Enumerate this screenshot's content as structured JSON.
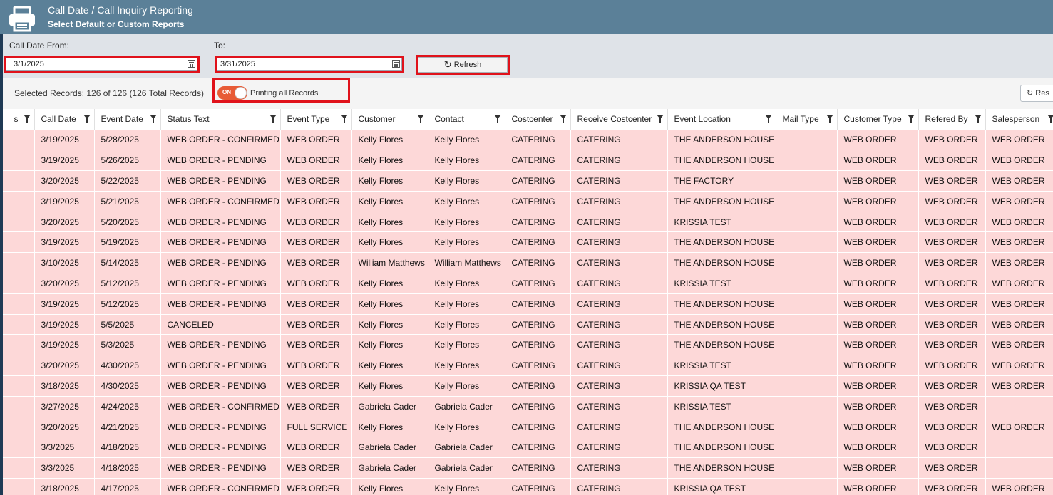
{
  "header": {
    "title": "Call Date / Call Inquiry Reporting",
    "subtitle": "Select Default or Custom Reports",
    "icon": "printer-icon"
  },
  "filters": {
    "from_label": "Call Date From:",
    "from_value": "3/1/2025",
    "to_label": "To:",
    "to_value": "3/31/2025",
    "refresh_label": "Refresh"
  },
  "records": {
    "summary": "Selected Records: 126 of 126 (126 Total Records)",
    "toggle_state": "ON",
    "toggle_label": "Printing all Records",
    "reset_label": "Res"
  },
  "table": {
    "columns": [
      "s",
      "Call Date",
      "Event Date",
      "Status Text",
      "Event Type",
      "Customer",
      "Contact",
      "Costcenter",
      "Receive Costcenter",
      "Event Location",
      "Mail Type",
      "Customer Type",
      "Refered By",
      "Salesperson"
    ],
    "rows": [
      [
        "",
        "3/19/2025",
        "5/28/2025",
        "WEB ORDER - CONFIRMED",
        "WEB ORDER",
        "Kelly Flores",
        "Kelly Flores",
        "CATERING",
        "CATERING",
        "THE ANDERSON HOUSE",
        "",
        "WEB ORDER",
        "WEB ORDER",
        "WEB ORDER"
      ],
      [
        "",
        "3/19/2025",
        "5/26/2025",
        "WEB ORDER - PENDING",
        "WEB ORDER",
        "Kelly Flores",
        "Kelly Flores",
        "CATERING",
        "CATERING",
        "THE ANDERSON HOUSE",
        "",
        "WEB ORDER",
        "WEB ORDER",
        "WEB ORDER"
      ],
      [
        "",
        "3/20/2025",
        "5/22/2025",
        "WEB ORDER - PENDING",
        "WEB ORDER",
        "Kelly Flores",
        "Kelly Flores",
        "CATERING",
        "CATERING",
        "THE FACTORY",
        "",
        "WEB ORDER",
        "WEB ORDER",
        "WEB ORDER"
      ],
      [
        "",
        "3/19/2025",
        "5/21/2025",
        "WEB ORDER - CONFIRMED",
        "WEB ORDER",
        "Kelly Flores",
        "Kelly Flores",
        "CATERING",
        "CATERING",
        "THE ANDERSON HOUSE",
        "",
        "WEB ORDER",
        "WEB ORDER",
        "WEB ORDER"
      ],
      [
        "",
        "3/20/2025",
        "5/20/2025",
        "WEB ORDER - PENDING",
        "WEB ORDER",
        "Kelly Flores",
        "Kelly Flores",
        "CATERING",
        "CATERING",
        "KRISSIA TEST",
        "",
        "WEB ORDER",
        "WEB ORDER",
        "WEB ORDER"
      ],
      [
        "",
        "3/19/2025",
        "5/19/2025",
        "WEB ORDER - PENDING",
        "WEB ORDER",
        "Kelly Flores",
        "Kelly Flores",
        "CATERING",
        "CATERING",
        "THE ANDERSON HOUSE",
        "",
        "WEB ORDER",
        "WEB ORDER",
        "WEB ORDER"
      ],
      [
        "",
        "3/10/2025",
        "5/14/2025",
        "WEB ORDER - PENDING",
        "WEB ORDER",
        "William Matthews",
        "William Matthews",
        "CATERING",
        "CATERING",
        "THE ANDERSON HOUSE",
        "",
        "WEB ORDER",
        "WEB ORDER",
        "WEB ORDER"
      ],
      [
        "",
        "3/20/2025",
        "5/12/2025",
        "WEB ORDER - PENDING",
        "WEB ORDER",
        "Kelly Flores",
        "Kelly Flores",
        "CATERING",
        "CATERING",
        "KRISSIA TEST",
        "",
        "WEB ORDER",
        "WEB ORDER",
        "WEB ORDER"
      ],
      [
        "",
        "3/19/2025",
        "5/12/2025",
        "WEB ORDER - PENDING",
        "WEB ORDER",
        "Kelly Flores",
        "Kelly Flores",
        "CATERING",
        "CATERING",
        "THE ANDERSON HOUSE",
        "",
        "WEB ORDER",
        "WEB ORDER",
        "WEB ORDER"
      ],
      [
        "",
        "3/19/2025",
        "5/5/2025",
        "CANCELED",
        "WEB ORDER",
        "Kelly Flores",
        "Kelly Flores",
        "CATERING",
        "CATERING",
        "THE ANDERSON HOUSE",
        "",
        "WEB ORDER",
        "WEB ORDER",
        "WEB ORDER"
      ],
      [
        "",
        "3/19/2025",
        "5/3/2025",
        "WEB ORDER - PENDING",
        "WEB ORDER",
        "Kelly Flores",
        "Kelly Flores",
        "CATERING",
        "CATERING",
        "THE ANDERSON HOUSE",
        "",
        "WEB ORDER",
        "WEB ORDER",
        "WEB ORDER"
      ],
      [
        "",
        "3/20/2025",
        "4/30/2025",
        "WEB ORDER - PENDING",
        "WEB ORDER",
        "Kelly Flores",
        "Kelly Flores",
        "CATERING",
        "CATERING",
        "KRISSIA TEST",
        "",
        "WEB ORDER",
        "WEB ORDER",
        "WEB ORDER"
      ],
      [
        "",
        "3/18/2025",
        "4/30/2025",
        "WEB ORDER - PENDING",
        "WEB ORDER",
        "Kelly Flores",
        "Kelly Flores",
        "CATERING",
        "CATERING",
        "KRISSIA QA TEST",
        "",
        "WEB ORDER",
        "WEB ORDER",
        "WEB ORDER"
      ],
      [
        "",
        "3/27/2025",
        "4/24/2025",
        "WEB ORDER - CONFIRMED",
        "WEB ORDER",
        "Gabriela Cader",
        "Gabriela Cader",
        "CATERING",
        "CATERING",
        "KRISSIA TEST",
        "",
        "WEB ORDER",
        "WEB ORDER",
        ""
      ],
      [
        "",
        "3/20/2025",
        "4/21/2025",
        "WEB ORDER - PENDING",
        "FULL SERVICE",
        "Kelly Flores",
        "Kelly Flores",
        "CATERING",
        "CATERING",
        "THE ANDERSON HOUSE",
        "",
        "WEB ORDER",
        "WEB ORDER",
        "WEB ORDER"
      ],
      [
        "",
        "3/3/2025",
        "4/18/2025",
        "WEB ORDER - PENDING",
        "WEB ORDER",
        "Gabriela Cader",
        "Gabriela Cader",
        "CATERING",
        "CATERING",
        "THE ANDERSON HOUSE",
        "",
        "WEB ORDER",
        "WEB ORDER",
        ""
      ],
      [
        "",
        "3/3/2025",
        "4/18/2025",
        "WEB ORDER - PENDING",
        "WEB ORDER",
        "Gabriela Cader",
        "Gabriela Cader",
        "CATERING",
        "CATERING",
        "THE ANDERSON HOUSE",
        "",
        "WEB ORDER",
        "WEB ORDER",
        ""
      ],
      [
        "",
        "3/18/2025",
        "4/17/2025",
        "WEB ORDER - CONFIRMED",
        "WEB ORDER",
        "Kelly Flores",
        "Kelly Flores",
        "CATERING",
        "CATERING",
        "KRISSIA QA TEST",
        "",
        "WEB ORDER",
        "WEB ORDER",
        "WEB ORDER"
      ]
    ]
  },
  "colors": {
    "header_bg": "#5b8098",
    "row_bg": "#fdd8d8",
    "highlight_border": "#e0121b",
    "toggle_on": "#e85b36"
  }
}
